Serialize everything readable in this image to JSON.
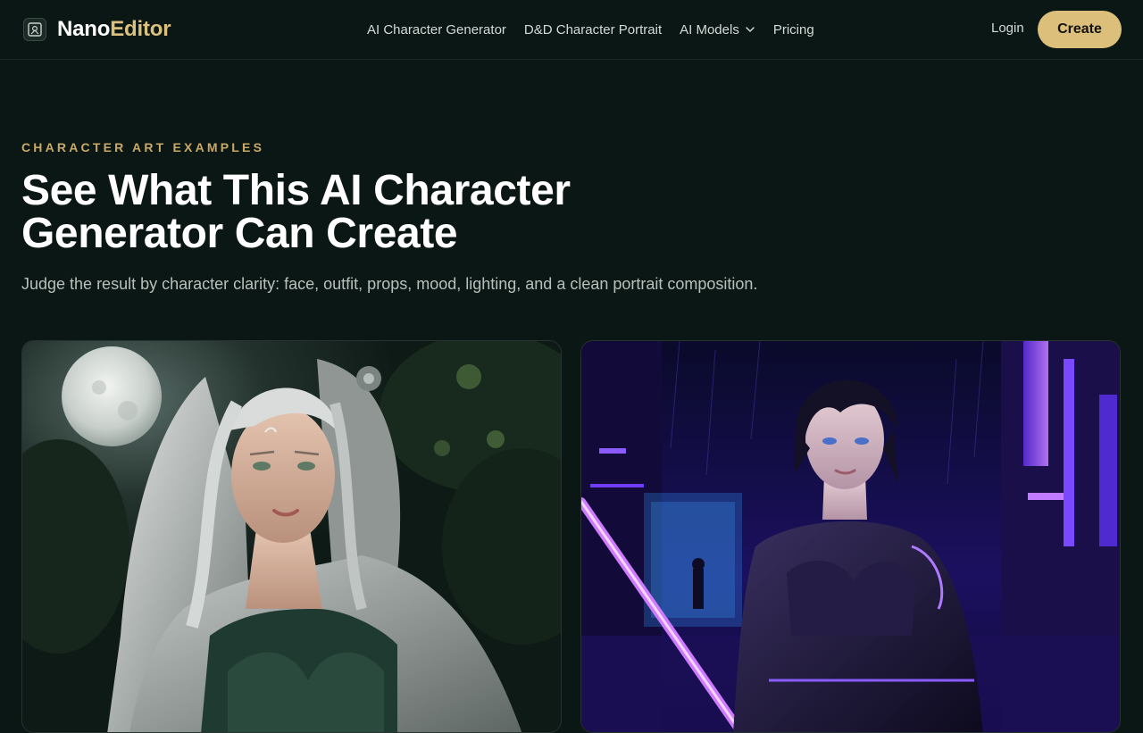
{
  "nav": {
    "brand_part1": "Nano",
    "brand_part2": "Editor",
    "links": [
      {
        "label": "AI Character Generator"
      },
      {
        "label": "D&D Character Portrait"
      },
      {
        "label": "AI Models"
      },
      {
        "label": "Pricing"
      }
    ],
    "login_label": "Login",
    "create_label": "Create"
  },
  "hero": {
    "eyebrow": "CHARACTER ART EXAMPLES",
    "title_line1": "See What This AI Character",
    "title_line2": "Generator Can Create",
    "subtitle": "Judge the result by character clarity: face, outfit, props, mood, lighting, and a clean portrait composition."
  },
  "colors": {
    "background": "#0b1714",
    "accent_gold": "#dcbf7b",
    "eyebrow_gold": "#c9a968"
  },
  "icons": {
    "brand": "frame-spark-icon",
    "dropdown": "chevron-down-icon"
  }
}
